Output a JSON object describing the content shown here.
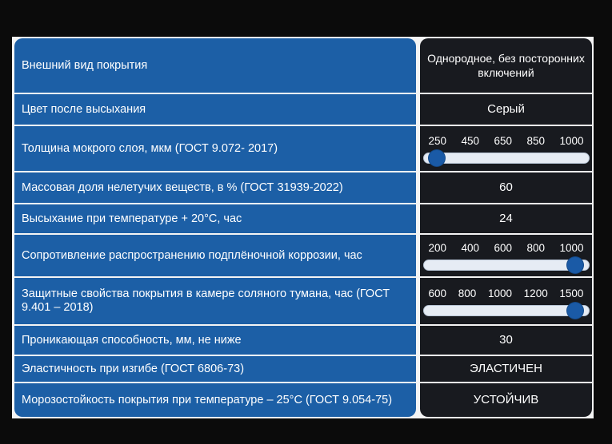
{
  "rows": [
    {
      "label": "Внешний вид покрытия",
      "value": "Однородное, без посторонних включений"
    },
    {
      "label": "Цвет после высыхания",
      "value": "Серый"
    },
    {
      "label": "Толщина мокрого слоя, мкм (ГОСТ 9.072- 2017)",
      "slider": {
        "ticks": [
          "250",
          "450",
          "650",
          "850",
          "1000"
        ],
        "position": 0.08
      }
    },
    {
      "label": "Массовая доля нелетучих веществ, в % (ГОСТ 31939-2022)",
      "value": "60"
    },
    {
      "label": "Высыхание при температуре + 20°С, час",
      "value": "24"
    },
    {
      "label": "Сопротивление распространению подплёночной коррозии, час",
      "slider": {
        "ticks": [
          "200",
          "400",
          "600",
          "800",
          "1000"
        ],
        "position": 0.92
      }
    },
    {
      "label": "Защитные свойства покрытия в камере соляного тумана, час (ГОСТ 9.401 – 2018)",
      "slider": {
        "ticks": [
          "600",
          "800",
          "1000",
          "1200",
          "1500"
        ],
        "position": 0.92
      }
    },
    {
      "label": "Проникающая способность, мм, не ниже",
      "value": "30"
    },
    {
      "label": "Эластичность при изгибе (ГОСТ 6806-73)",
      "value": "ЭЛАСТИЧЕН"
    },
    {
      "label": "Морозостойкость покрытия при температуре – 25°С (ГОСТ 9.054-75)",
      "value": "УСТОЙЧИВ"
    }
  ],
  "colors": {
    "label_bg": "#1c5fa6",
    "value_bg": "#181a1f",
    "slider_knob": "#1a5aa6"
  }
}
